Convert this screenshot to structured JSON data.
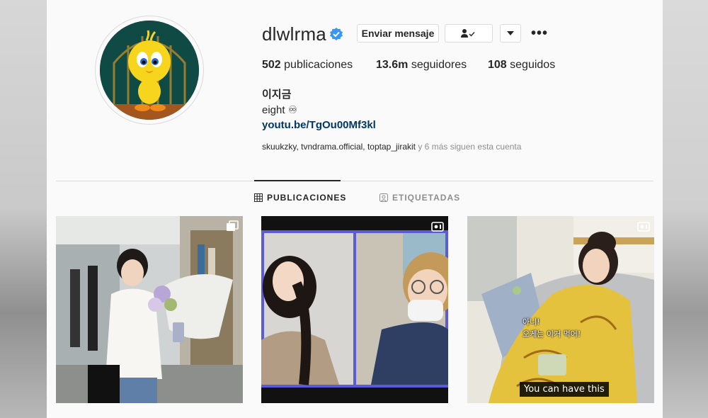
{
  "profile": {
    "username": "dlwlrma",
    "verified": true,
    "full_name": "이지금",
    "bio": "eight ♾",
    "link": "youtu.be/TgOu00Mf3kl"
  },
  "actions": {
    "message_label": "Enviar mensaje",
    "following_icon": "person-check-icon",
    "dropdown_icon": "chevron-down-icon",
    "more_label": "•••"
  },
  "stats": {
    "posts_value": "502",
    "posts_label": "publicaciones",
    "followers_value": "13.6m",
    "followers_label": "seguidores",
    "following_value": "108",
    "following_label": "seguidos"
  },
  "followed_by": {
    "accounts": [
      "skuukzky",
      "tvndrama.official",
      "toptap_jirakit"
    ],
    "sep1": ", ",
    "sep2": ", ",
    "suffix": " y 6 más siguen esta cuenta"
  },
  "tabs": [
    {
      "label": "PUBLICACIONES",
      "icon": "grid-icon",
      "active": true
    },
    {
      "label": "ETIQUETADAS",
      "icon": "tag-person-icon",
      "active": false
    }
  ],
  "posts": [
    {
      "type_icon": "carousel-icon",
      "overlay": ""
    },
    {
      "type_icon": "igtv-icon",
      "overlay": ""
    },
    {
      "type_icon": "igtv-icon",
      "overlay_line1": "아니!",
      "overlay_line2": "오케는 이거 먹어!",
      "subtitle": "You can have this"
    }
  ],
  "colors": {
    "link": "#00376b",
    "verified": "#3897f0",
    "text": "#262626",
    "muted": "#8e8e8e",
    "border": "#dbdbdb"
  }
}
